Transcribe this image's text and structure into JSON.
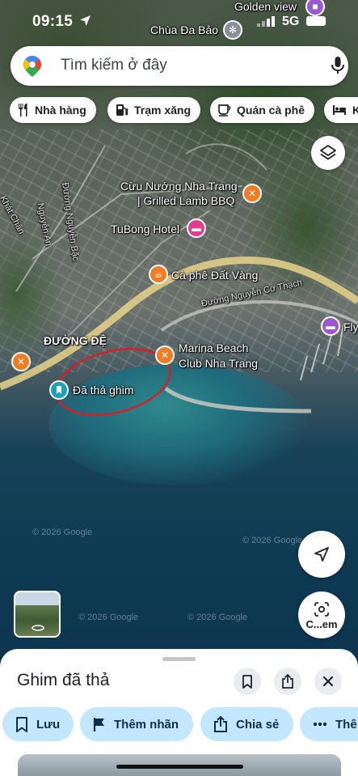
{
  "status_bar": {
    "time": "09:15",
    "network": "5G"
  },
  "search": {
    "placeholder": "Tìm kiếm ở đây"
  },
  "chips": [
    {
      "label": "Nhà hàng",
      "icon": "fork-knife-icon"
    },
    {
      "label": "Trạm xăng",
      "icon": "gas-pump-icon"
    },
    {
      "label": "Quán cà phê",
      "icon": "coffee-cup-icon"
    },
    {
      "label": "K",
      "icon": "bed-icon"
    }
  ],
  "map": {
    "labels": {
      "golden_view": "Golden view",
      "chua_da_bao": "Chùa Đa Bảo",
      "cuu_nuong_1": "Cừu Nướng Nha Trang",
      "cuu_nuong_2": "| Grilled Lamb BBQ",
      "tubong": "TuBong Hotel",
      "ca_phe": "Cà phê Đất Vàng",
      "nguyen_co_thach": "Đường Nguyễn Cơ Thạch",
      "fly": "Fly",
      "duong_de": "ĐƯỜNG ĐỆ",
      "marina_1": "Marina Beach",
      "marina_2": "Club Nha Trang",
      "dropped_pin": "Đã thả ghim",
      "nguyen_an": "Nguyễn An",
      "nguyen_bac": "Đường Nguyễn Bặc",
      "khat_chan": "Khát Chân",
      "copyright_1": "© 2026 Google",
      "copyright_2": "© 2026 Google",
      "copyright_3": "© 2026 Google",
      "copyright_4": "© 2026 Google"
    }
  },
  "camera_button": {
    "label": "C...em"
  },
  "sheet": {
    "title": "Ghim đã thả",
    "actions": [
      {
        "label": "Lưu",
        "icon": "bookmark-icon"
      },
      {
        "label": "Thêm nhãn",
        "icon": "flag-icon"
      },
      {
        "label": "Chia sẻ",
        "icon": "share-icon"
      },
      {
        "label": "Thê",
        "icon": "more-horizontal-icon"
      }
    ]
  },
  "colors": {
    "chip_bg": "#ffffff",
    "action_bg": "#c2e7ff",
    "poi_orange": "#f07c23",
    "poi_pink": "#e23d8f",
    "poi_purple": "#9b59d0",
    "pin_teal": "#1aa3b5",
    "red_circle": "#d62028"
  }
}
